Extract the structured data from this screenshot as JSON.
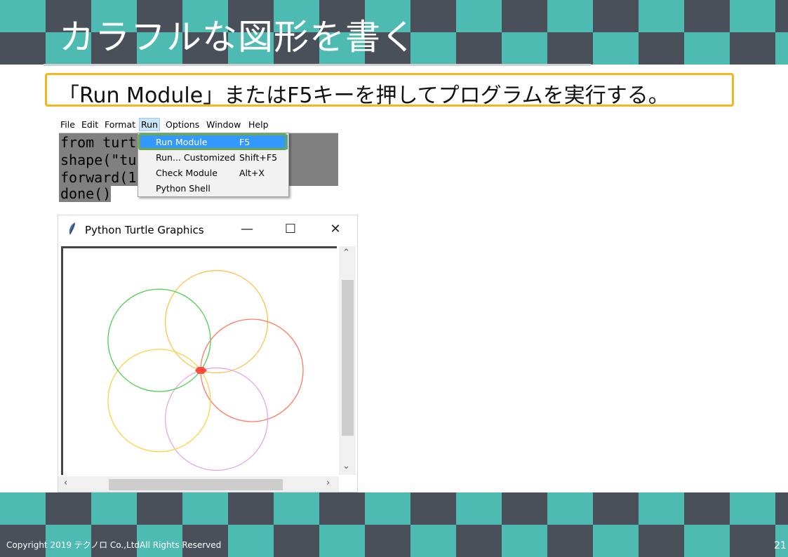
{
  "slide": {
    "title": "カラフルな図形を書く",
    "instruction": "「Run Module」またはF5キーを押してプログラムを実行する。",
    "copyright": "Copyright 2019  テクノロ Co.,LtdAll Rights Reserved",
    "page_number": "21"
  },
  "colors": {
    "checker_teal": "#4dbbb1",
    "checker_dark": "#4a5059",
    "callout_border": "#f2b61e",
    "menu_highlight": "#3399ff",
    "highlight_ring": "#6aa84f"
  },
  "idle": {
    "menu": [
      "File",
      "Edit",
      "Format",
      "Run",
      "Options",
      "Window",
      "Help"
    ],
    "active_menu": "Run",
    "code_lines": [
      "from turt",
      "shape(\"tu",
      "forward(1(",
      "done()"
    ],
    "run_menu": [
      {
        "label": "Run Module",
        "accel": "F5"
      },
      {
        "label": "Run... Customized",
        "accel": "Shift+F5"
      },
      {
        "label": "Check Module",
        "accel": "Alt+X"
      },
      {
        "label": "Python Shell",
        "accel": ""
      }
    ]
  },
  "turtle_window": {
    "title": "Python Turtle Graphics",
    "minimize_glyph": "—",
    "maximize_glyph": "☐",
    "close_glyph": "✕",
    "circle_colors": [
      "#ffc04d",
      "#ff7a60",
      "#e3a8e0",
      "#ffd23d",
      "#4fd04f"
    ],
    "turtle_color": "#ff4b3a"
  }
}
